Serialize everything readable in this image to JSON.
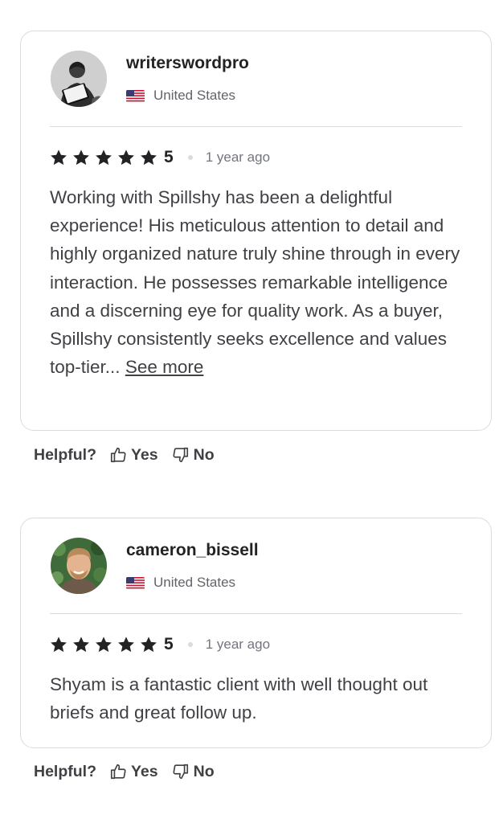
{
  "reviews": [
    {
      "username": "writerswordpro",
      "country": "United States",
      "rating": "5",
      "time_ago": "1 year ago",
      "text": "Working with Spillshy has been a delightful experience! His meticulous attention to detail and highly organized nature truly shine through in every interaction. He possesses remarkable intelligence and a discerning eye for quality work. As a buyer, Spillshy consistently seeks excellence and values top-tier...",
      "see_more": "See more",
      "helpful_label": "Helpful?",
      "yes_label": "Yes",
      "no_label": "No",
      "avatar_icon": "user-avatar-reading-photo"
    },
    {
      "username": "cameron_bissell",
      "country": "United States",
      "rating": "5",
      "time_ago": "1 year ago",
      "text": "Shyam is a fantastic client with well thought out briefs and great follow up.",
      "helpful_label": "Helpful?",
      "yes_label": "Yes",
      "no_label": "No",
      "avatar_icon": "user-avatar-photo"
    }
  ],
  "icons": {
    "star": "star-icon",
    "flag": "us-flag-icon",
    "thumbs_up": "thumbs-up-icon",
    "thumbs_down": "thumbs-down-icon"
  },
  "colors": {
    "star": "#222325",
    "border": "#dadbdd",
    "text_primary": "#222325",
    "text_body": "#404145",
    "text_muted": "#74767e"
  }
}
